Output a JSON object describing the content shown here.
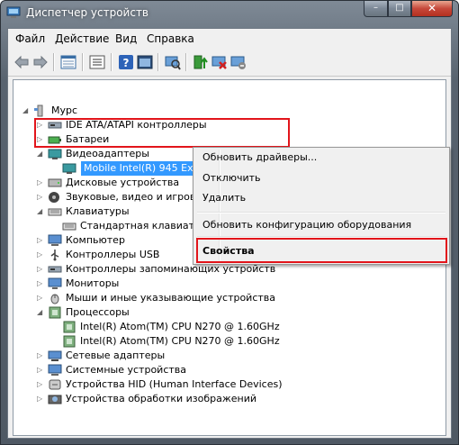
{
  "window": {
    "title": "Диспетчер устройств"
  },
  "title_buttons": {
    "min": "–",
    "max": "□",
    "close": "✕"
  },
  "menu": [
    "Файл",
    "Действие",
    "Вид",
    "Справка"
  ],
  "toolbar_icons": [
    "back-arrow-icon",
    "forward-arrow-icon",
    "properties-grid-icon",
    "list-icon",
    "help-icon",
    "console-icon",
    "scan-hardware-icon",
    "update-driver-icon",
    "disable-device-icon",
    "uninstall-device-icon"
  ],
  "tree": {
    "root": "Мурс",
    "items": [
      {
        "label": "IDE ATA/ATAPI контроллеры",
        "icon": "ide-controller-icon",
        "expanded": false
      },
      {
        "label": "Батареи",
        "icon": "battery-icon",
        "expanded": false
      },
      {
        "label": "Видеоадаптеры",
        "icon": "display-adapter-icon",
        "expanded": true,
        "children": [
          "Mobile Intel(R) 945 Express Chipset Family"
        ]
      },
      {
        "label": "Дисковые устройства",
        "icon": "disk-drive-icon",
        "expanded": false
      },
      {
        "label": "Звуковые, видео и игровые устройства",
        "icon": "sound-icon",
        "expanded": false
      },
      {
        "label": "Клавиатуры",
        "icon": "keyboard-icon",
        "expanded": true,
        "children": [
          "Стандартная клавиатура PS/2"
        ]
      },
      {
        "label": "Компьютер",
        "icon": "computer-icon",
        "expanded": false
      },
      {
        "label": "Контроллеры USB",
        "icon": "usb-icon",
        "expanded": false
      },
      {
        "label": "Контроллеры запоминающих устройств",
        "icon": "storage-controller-icon",
        "expanded": false
      },
      {
        "label": "Мониторы",
        "icon": "monitor-icon",
        "expanded": false
      },
      {
        "label": "Мыши и иные указывающие устройства",
        "icon": "mouse-icon",
        "expanded": false
      },
      {
        "label": "Процессоры",
        "icon": "cpu-icon",
        "expanded": true,
        "children": [
          "Intel(R) Atom(TM) CPU N270   @ 1.60GHz",
          "Intel(R) Atom(TM) CPU N270   @ 1.60GHz"
        ]
      },
      {
        "label": "Сетевые адаптеры",
        "icon": "network-adapter-icon",
        "expanded": false
      },
      {
        "label": "Системные устройства",
        "icon": "system-devices-icon",
        "expanded": false
      },
      {
        "label": "Устройства HID (Human Interface Devices)",
        "icon": "hid-icon",
        "expanded": false
      },
      {
        "label": "Устройства обработки изображений",
        "icon": "imaging-device-icon",
        "expanded": false
      }
    ]
  },
  "context_menu": {
    "items": [
      "Обновить драйверы...",
      "Отключить",
      "Удалить",
      "Обновить конфигурацию оборудования",
      "Свойства"
    ]
  },
  "colors": {
    "highlight": "#3399ff",
    "annotation": "#e2151b"
  }
}
